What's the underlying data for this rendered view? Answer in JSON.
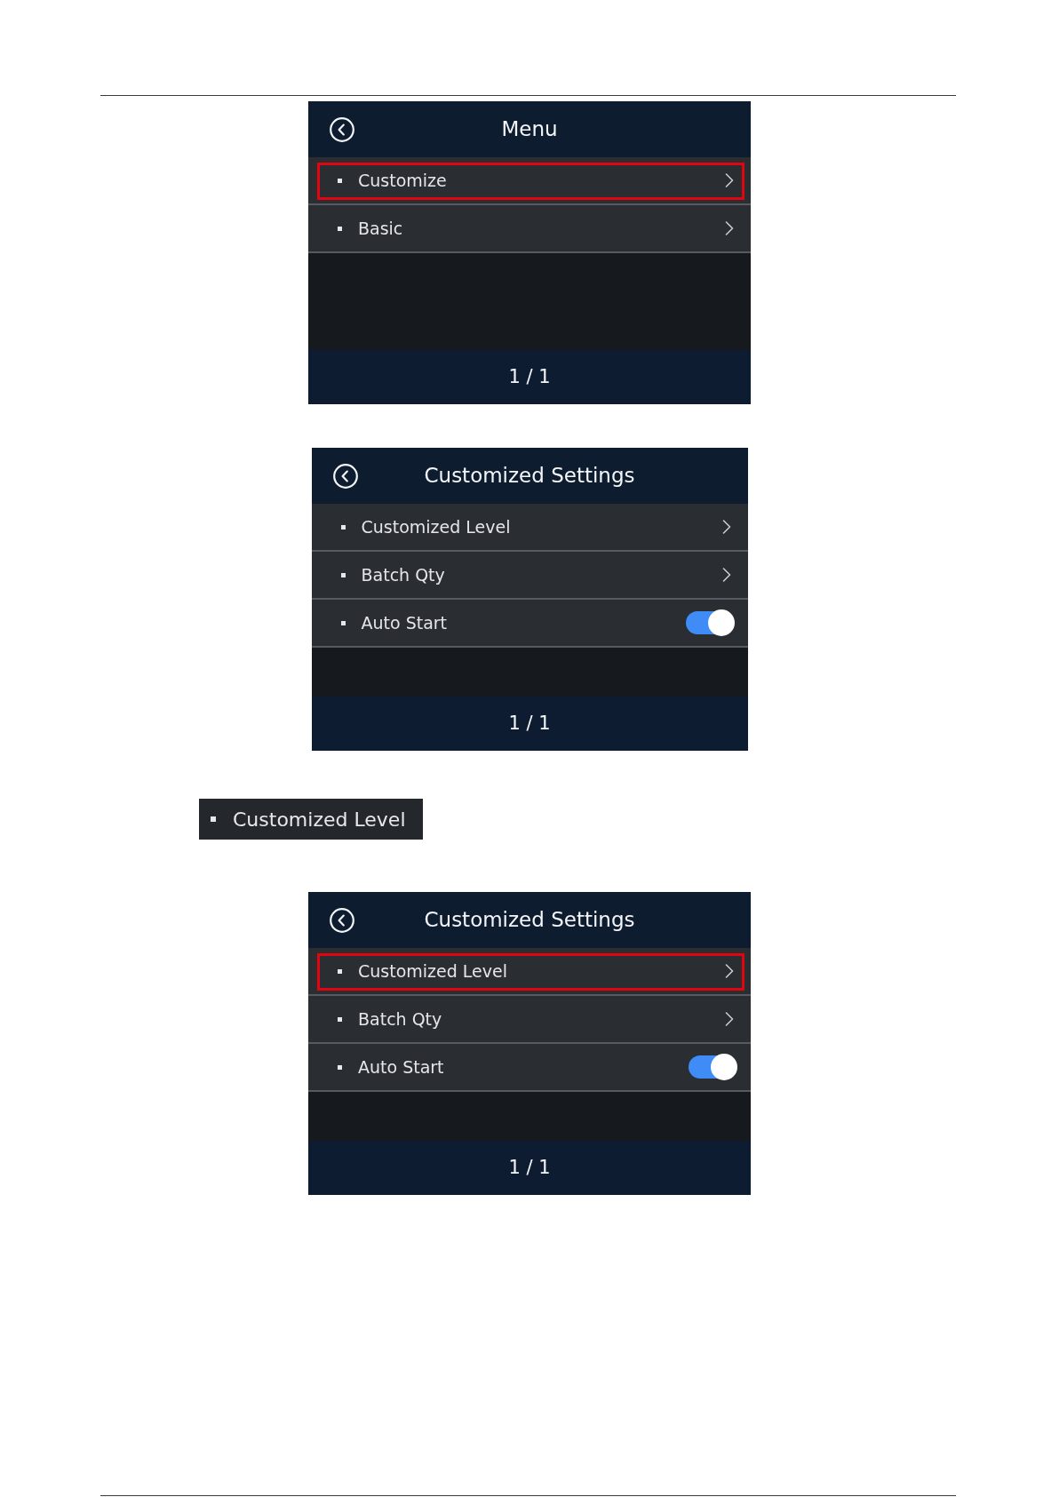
{
  "figures": [
    {
      "kind": "screen",
      "title": "Menu",
      "items": [
        {
          "kind": "link",
          "label": "Customize",
          "highlighted": true
        },
        {
          "kind": "link",
          "label": "Basic",
          "highlighted": false
        }
      ],
      "page": "1 / 1"
    },
    {
      "kind": "screen",
      "title": "Customized Settings",
      "items": [
        {
          "kind": "link",
          "label": "Customized Level",
          "highlighted": false
        },
        {
          "kind": "link",
          "label": "Batch Qty",
          "highlighted": false
        },
        {
          "kind": "toggle",
          "label": "Auto Start",
          "on": true,
          "highlighted": false
        }
      ],
      "page": "1 / 1"
    },
    {
      "kind": "row_snippet",
      "label": "Customized Level"
    },
    {
      "kind": "screen",
      "title": "Customized Settings",
      "items": [
        {
          "kind": "link",
          "label": "Customized Level",
          "highlighted": true
        },
        {
          "kind": "link",
          "label": "Batch Qty",
          "highlighted": false
        },
        {
          "kind": "toggle",
          "label": "Auto Start",
          "on": true,
          "highlighted": false
        }
      ],
      "page": "1 / 1"
    }
  ]
}
